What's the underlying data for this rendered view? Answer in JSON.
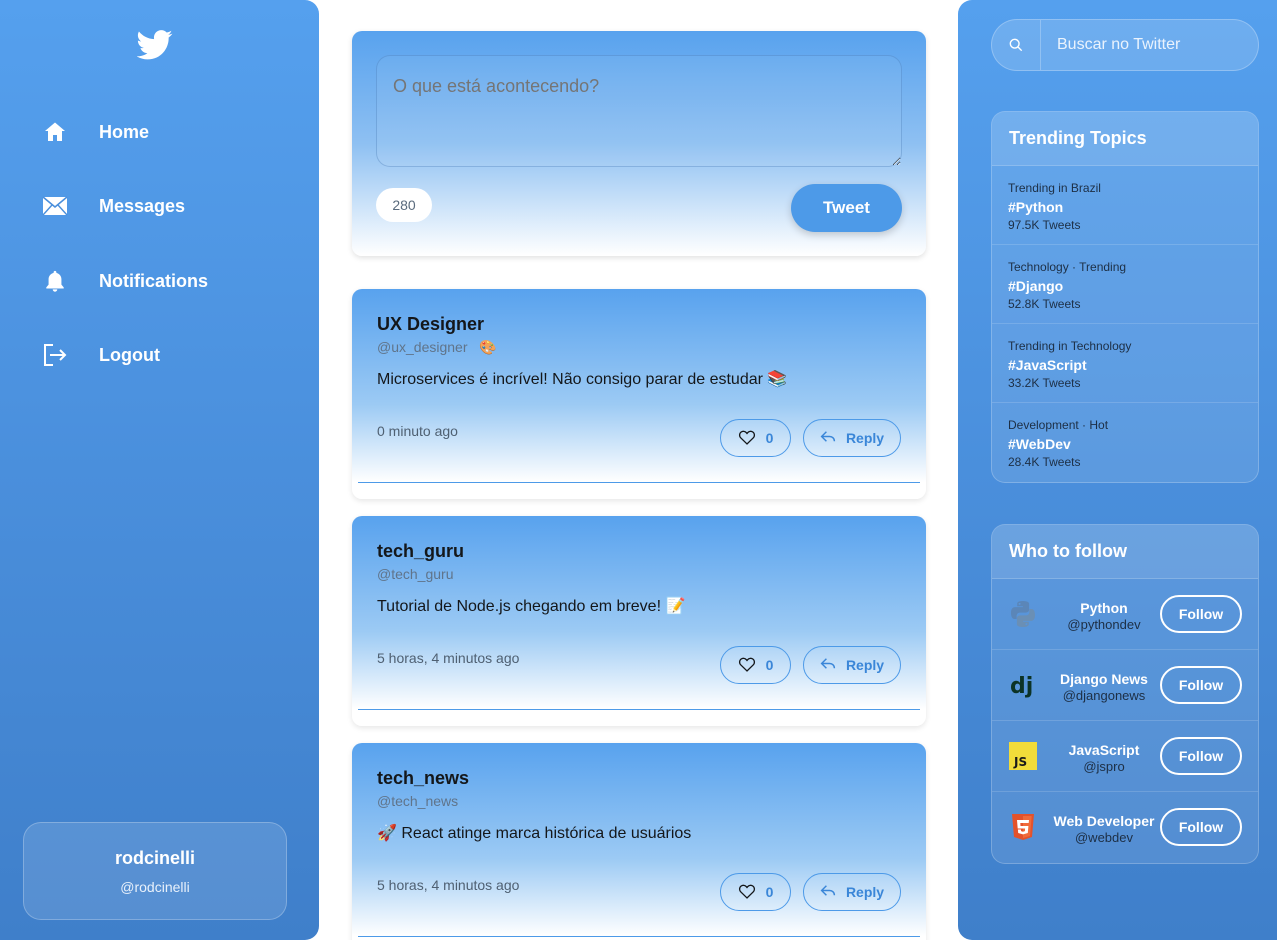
{
  "sidebar": {
    "logo": "twitter-bird-icon",
    "nav": [
      {
        "label": "Home",
        "icon": "home-icon"
      },
      {
        "label": "Messages",
        "icon": "envelope-icon"
      },
      {
        "label": "Notifications",
        "icon": "bell-icon"
      },
      {
        "label": "Logout",
        "icon": "logout-icon"
      }
    ],
    "profile": {
      "name": "rodcinelli",
      "handle": "@rodcinelli"
    }
  },
  "compose": {
    "placeholder": "O que está acontecendo?",
    "char_count": "280",
    "tweet_label": "Tweet"
  },
  "posts": [
    {
      "author": "UX Designer",
      "handle": "@ux_designer",
      "handle_emoji": "🎨",
      "content": "Microservices é incrível! Não consigo parar de estudar 📚",
      "time": "0 minuto ago",
      "likes": "0",
      "reply_label": "Reply"
    },
    {
      "author": "tech_guru",
      "handle": "@tech_guru",
      "handle_emoji": "",
      "content": "Tutorial de Node.js chegando em breve! 📝",
      "time": "5 horas, 4 minutos ago",
      "likes": "0",
      "reply_label": "Reply"
    },
    {
      "author": "tech_news",
      "handle": "@tech_news",
      "handle_emoji": "",
      "content": "🚀 React atinge marca histórica de usuários",
      "time": "5 horas, 4 minutos ago",
      "likes": "0",
      "reply_label": "Reply"
    }
  ],
  "search": {
    "placeholder": "Buscar no Twitter"
  },
  "trending": {
    "title": "Trending Topics",
    "items": [
      {
        "context": "Trending in Brazil",
        "tag": "#Python",
        "count": "97.5K Tweets"
      },
      {
        "context": "Technology · Trending",
        "tag": "#Django",
        "count": "52.8K Tweets"
      },
      {
        "context": "Trending in Technology",
        "tag": "#JavaScript",
        "count": "33.2K Tweets"
      },
      {
        "context": "Development · Hot",
        "tag": "#WebDev",
        "count": "28.4K Tweets"
      }
    ]
  },
  "who_to_follow": {
    "title": "Who to follow",
    "follow_label": "Follow",
    "items": [
      {
        "name": "Python",
        "handle": "@pythondev",
        "icon": "python-logo-icon"
      },
      {
        "name": "Django News",
        "handle": "@djangonews",
        "icon": "django-logo-icon"
      },
      {
        "name": "JavaScript",
        "handle": "@jspro",
        "icon": "javascript-logo-icon"
      },
      {
        "name": "Web Developer",
        "handle": "@webdev",
        "icon": "html5-logo-icon"
      }
    ]
  },
  "colors": {
    "accent": "#4d9ae8",
    "sidebar_top": "#55a0ee",
    "sidebar_bottom": "#3f7fca"
  }
}
